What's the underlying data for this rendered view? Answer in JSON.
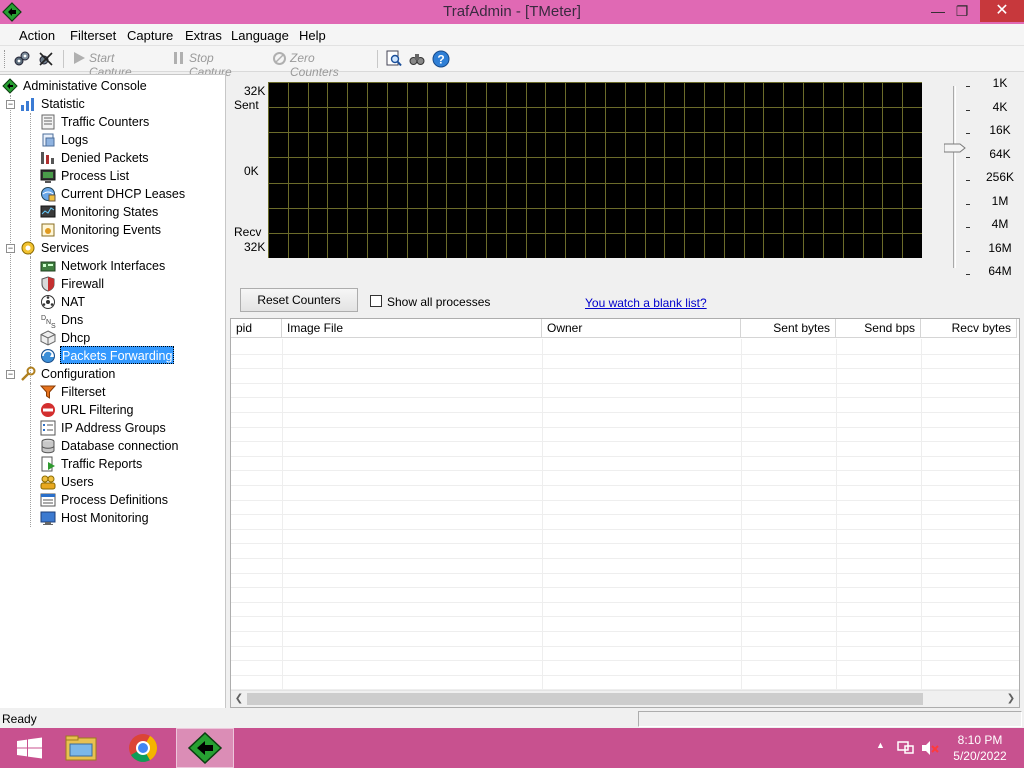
{
  "window": {
    "title": "TrafAdmin - [TMeter]"
  },
  "menu": [
    "Action",
    "Filterset",
    "Capture",
    "Extras",
    "Language",
    "Help"
  ],
  "toolbar": {
    "start_capture": "Start Capture",
    "stop_capture": "Stop Capture",
    "zero_counters": "Zero Counters"
  },
  "tree": {
    "root": "Administative Console",
    "statistic": {
      "label": "Statistic",
      "items": [
        "Traffic Counters",
        "Logs",
        "Denied Packets",
        "Process List",
        "Current DHCP Leases",
        "Monitoring States",
        "Monitoring Events"
      ]
    },
    "services": {
      "label": "Services",
      "items": [
        "Network Interfaces",
        "Firewall",
        "NAT",
        "Dns",
        "Dhcp",
        "Packets Forwarding"
      ]
    },
    "configuration": {
      "label": "Configuration",
      "items": [
        "Filterset",
        "URL Filtering",
        "IP Address Groups",
        "Database connection",
        "Traffic Reports",
        "Users",
        "Process Definitions",
        "Host Monitoring"
      ]
    },
    "selected": "Packets Forwarding"
  },
  "graph": {
    "top_value": "32K",
    "top_label": "Sent",
    "mid_value": "0K",
    "bottom_label": "Recv",
    "bottom_value": "32K",
    "scale": [
      "1K",
      "4K",
      "16K",
      "64K",
      "256K",
      "1M",
      "4M",
      "16M",
      "64M"
    ],
    "scale_selected": "16K"
  },
  "controls": {
    "reset_button": "Reset Counters",
    "show_all_label": "Show all processes",
    "show_all_checked": false,
    "help_link": "You watch a blank list?"
  },
  "table": {
    "columns": [
      "pid",
      "Image File",
      "Owner",
      "Sent bytes",
      "Send bps",
      "Recv bytes"
    ],
    "rows": []
  },
  "status": {
    "text": "Ready"
  },
  "taskbar": {
    "time": "8:10 PM",
    "date": "5/20/2022"
  },
  "colors": {
    "titlebar": "#e069b4",
    "taskbar": "#c8518f",
    "graph_bg": "#000000",
    "graph_grid": "#6b6b2a",
    "selection": "#3399ff",
    "link": "#0000cc"
  }
}
